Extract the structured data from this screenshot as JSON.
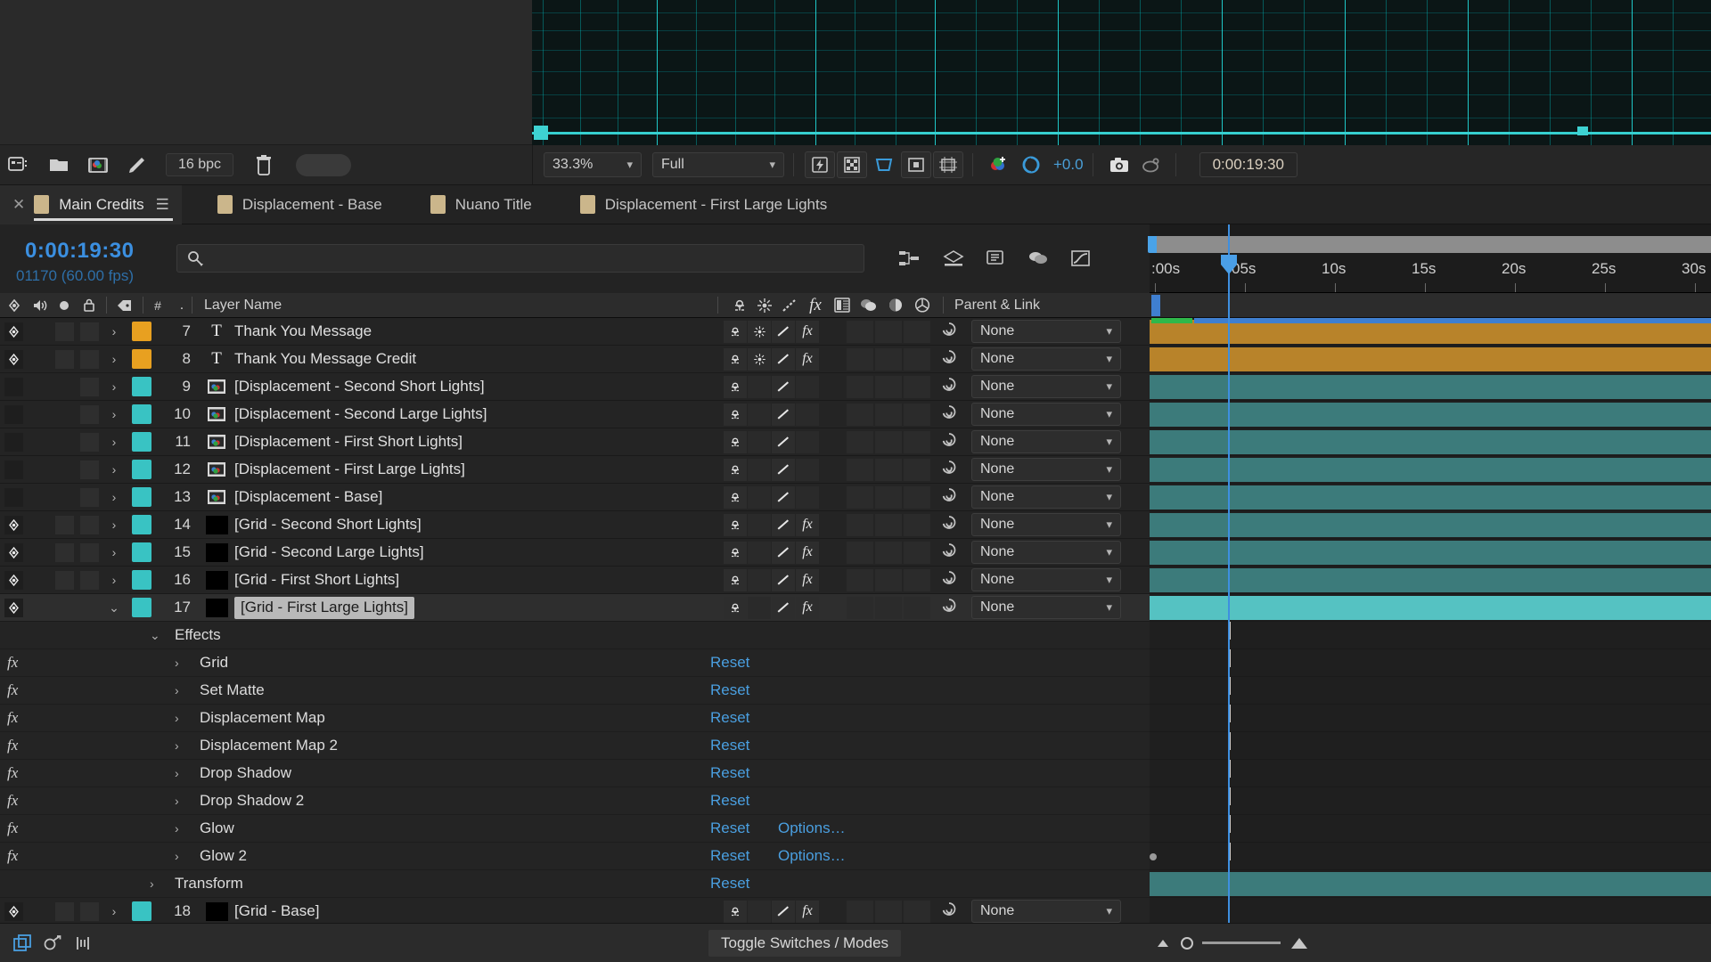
{
  "app": "Adobe After Effects",
  "project_toolbar": {
    "icons": [
      "project-settings-icon",
      "new-folder-icon",
      "new-comp-icon",
      "interpret-footage-icon",
      "delete-icon"
    ],
    "bit_depth": "16 bpc"
  },
  "viewer_toolbar": {
    "zoom_level": "33.3%",
    "resolution": "Full",
    "exposure": "+0.0",
    "timecode": "0:00:19:30",
    "buttons": [
      "fast-previews-icon",
      "transparency-grid-icon",
      "region-of-interest-icon",
      "toggle-mask-icon",
      "grid-guides-icon",
      "channel-icon",
      "exposure-icon",
      "snapshot-icon",
      "show-snapshot-icon"
    ]
  },
  "tabs": [
    {
      "label": "Main Credits",
      "active": true
    },
    {
      "label": "Displacement - Base",
      "active": false
    },
    {
      "label": "Nuano Title",
      "active": false
    },
    {
      "label": "Displacement - First Large Lights",
      "active": false
    }
  ],
  "timeline": {
    "current_timecode": "0:00:19:30",
    "frame_info": "01170 (60.00 fps)",
    "search_placeholder": "",
    "header_buttons": [
      "composition-mini-flowchart-icon",
      "draft-3d-icon",
      "hide-shy-layers-icon",
      "frame-blending-icon",
      "motion-blur-icon",
      "graph-editor-icon"
    ],
    "columns": {
      "video_icon": "eye-icon",
      "audio_icon": "speaker-icon",
      "solo_icon": "solo-icon",
      "lock_icon": "lock-icon",
      "label_icon": "label-tag-icon",
      "index": "#",
      "layer_name": "Layer Name",
      "switches": [
        "shy-icon",
        "collapse-transformations-icon",
        "quality-icon",
        "effects-icon",
        "frame-blend-icon",
        "motion-blur-icon",
        "adjustment-layer-icon",
        "3d-layer-icon"
      ],
      "parent_and_link": "Parent & Link"
    },
    "ruler_labels": [
      ":00s",
      "05s",
      "10s",
      "15s",
      "20s",
      "25s",
      "30s"
    ],
    "parent_default": "None"
  },
  "layers": [
    {
      "index": "7",
      "name": "Thank You Message",
      "type": "T",
      "label_color": "#e8a020",
      "visible": true,
      "twirl": "closed",
      "selected": false,
      "bar": "orange",
      "has_fx": true
    },
    {
      "index": "8",
      "name": "Thank You Message Credit",
      "type": "T",
      "label_color": "#e8a020",
      "visible": true,
      "twirl": "closed",
      "selected": false,
      "bar": "orange",
      "has_fx": true
    },
    {
      "index": "9",
      "name": "[Displacement - Second Short Lights]",
      "type": "comp",
      "label_color": "#39c3c3",
      "visible": false,
      "twirl": "closed",
      "selected": false,
      "bar": "teal",
      "has_fx": false
    },
    {
      "index": "10",
      "name": "[Displacement - Second Large Lights]",
      "type": "comp",
      "label_color": "#39c3c3",
      "visible": false,
      "twirl": "closed",
      "selected": false,
      "bar": "teal",
      "has_fx": false
    },
    {
      "index": "11",
      "name": "[Displacement - First Short Lights]",
      "type": "comp",
      "label_color": "#39c3c3",
      "visible": false,
      "twirl": "closed",
      "selected": false,
      "bar": "teal",
      "has_fx": false
    },
    {
      "index": "12",
      "name": "[Displacement - First Large Lights]",
      "type": "comp",
      "label_color": "#39c3c3",
      "visible": false,
      "twirl": "closed",
      "selected": false,
      "bar": "teal",
      "has_fx": false
    },
    {
      "index": "13",
      "name": "[Displacement - Base]",
      "type": "comp",
      "label_color": "#39c3c3",
      "visible": false,
      "twirl": "closed",
      "selected": false,
      "bar": "teal",
      "has_fx": false
    },
    {
      "index": "14",
      "name": "[Grid - Second Short Lights]",
      "type": "solid",
      "label_color": "#39c3c3",
      "visible": true,
      "twirl": "closed",
      "selected": false,
      "bar": "teal",
      "has_fx": true
    },
    {
      "index": "15",
      "name": "[Grid - Second Large Lights]",
      "type": "solid",
      "label_color": "#39c3c3",
      "visible": true,
      "twirl": "closed",
      "selected": false,
      "bar": "teal",
      "has_fx": true
    },
    {
      "index": "16",
      "name": "[Grid - First Short Lights]",
      "type": "solid",
      "label_color": "#39c3c3",
      "visible": true,
      "twirl": "closed",
      "selected": false,
      "bar": "teal",
      "has_fx": true
    },
    {
      "index": "17",
      "name": "[Grid - First Large Lights]",
      "type": "solid",
      "label_color": "#39c3c3",
      "visible": true,
      "twirl": "open",
      "selected": true,
      "bar": "teal-sel",
      "has_fx": true
    }
  ],
  "expanded_layer": {
    "group_label": "Effects",
    "effects": [
      {
        "name": "Grid",
        "reset": "Reset",
        "options": ""
      },
      {
        "name": "Set Matte",
        "reset": "Reset",
        "options": ""
      },
      {
        "name": "Displacement Map",
        "reset": "Reset",
        "options": ""
      },
      {
        "name": "Displacement Map 2",
        "reset": "Reset",
        "options": ""
      },
      {
        "name": "Drop Shadow",
        "reset": "Reset",
        "options": ""
      },
      {
        "name": "Drop Shadow 2",
        "reset": "Reset",
        "options": ""
      },
      {
        "name": "Glow",
        "reset": "Reset",
        "options": "Options…"
      },
      {
        "name": "Glow 2",
        "reset": "Reset",
        "options": "Options…"
      }
    ],
    "transform": {
      "name": "Transform",
      "reset": "Reset"
    }
  },
  "trailing_layer": {
    "index": "18",
    "name": "[Grid - Base]",
    "type": "solid",
    "label_color": "#39c3c3",
    "visible": true,
    "bar": "teal"
  },
  "bottom_bar": {
    "toggle_label": "Toggle Switches / Modes",
    "icons": [
      "comp-flowchart-icon",
      "render-queue-icon",
      "graph-editor-icon"
    ]
  },
  "colors": {
    "accent_blue": "#3e8fe0",
    "link_blue": "#4a9fe0",
    "label_orange": "#e8a020",
    "label_teal": "#39c3c3",
    "bar_orange": "#b8832a",
    "bar_teal": "#3c7b7b",
    "bar_teal_selected": "#55c2c2",
    "panel_bg": "#232323"
  }
}
